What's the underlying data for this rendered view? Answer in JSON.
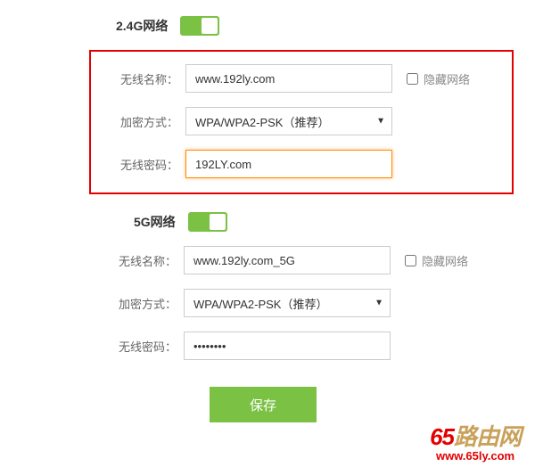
{
  "band24": {
    "title": "2.4G网络",
    "ssid_label": "无线名称：",
    "ssid_value": "www.192ly.com",
    "hide_label": "隐藏网络",
    "enc_label": "加密方式：",
    "enc_value": "WPA/WPA2-PSK（推荐）",
    "pwd_label": "无线密码：",
    "pwd_value": "192LY.com"
  },
  "band5g": {
    "title": "5G网络",
    "ssid_label": "无线名称：",
    "ssid_value": "www.192ly.com_5G",
    "hide_label": "隐藏网络",
    "enc_label": "加密方式：",
    "enc_value": "WPA/WPA2-PSK（推荐）",
    "pwd_label": "无线密码：",
    "pwd_value": "••••••••"
  },
  "save_label": "保存",
  "watermark": {
    "top_a": "65",
    "top_b": "路由网",
    "bottom": "www.65ly.com"
  }
}
